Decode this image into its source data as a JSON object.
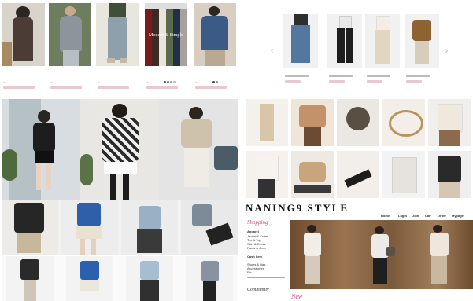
{
  "top_left_products": {
    "overlay_text": "Modern & Simple",
    "captions": [
      "...",
      "...",
      "...",
      "...",
      "..."
    ]
  },
  "brand": {
    "logo": "NANING9 STYLE",
    "nav": [
      "Home",
      "Login",
      "Join",
      "Cart",
      "Order",
      "Mypage"
    ]
  },
  "sidebar": {
    "shopping_title": "Shopping",
    "categories": [
      "Apparel",
      "Jacket & Outer",
      "Tee & Top",
      "Skirt & Dress",
      "Pants & Jean"
    ],
    "extras": [
      "Shoes & Bag",
      "Accessories",
      "Etc"
    ],
    "cash_item": "Cash Item",
    "community": "Community",
    "new_label": "New"
  },
  "colors": {
    "accent_red": "#c0392b",
    "pink": "#d63b7a"
  }
}
